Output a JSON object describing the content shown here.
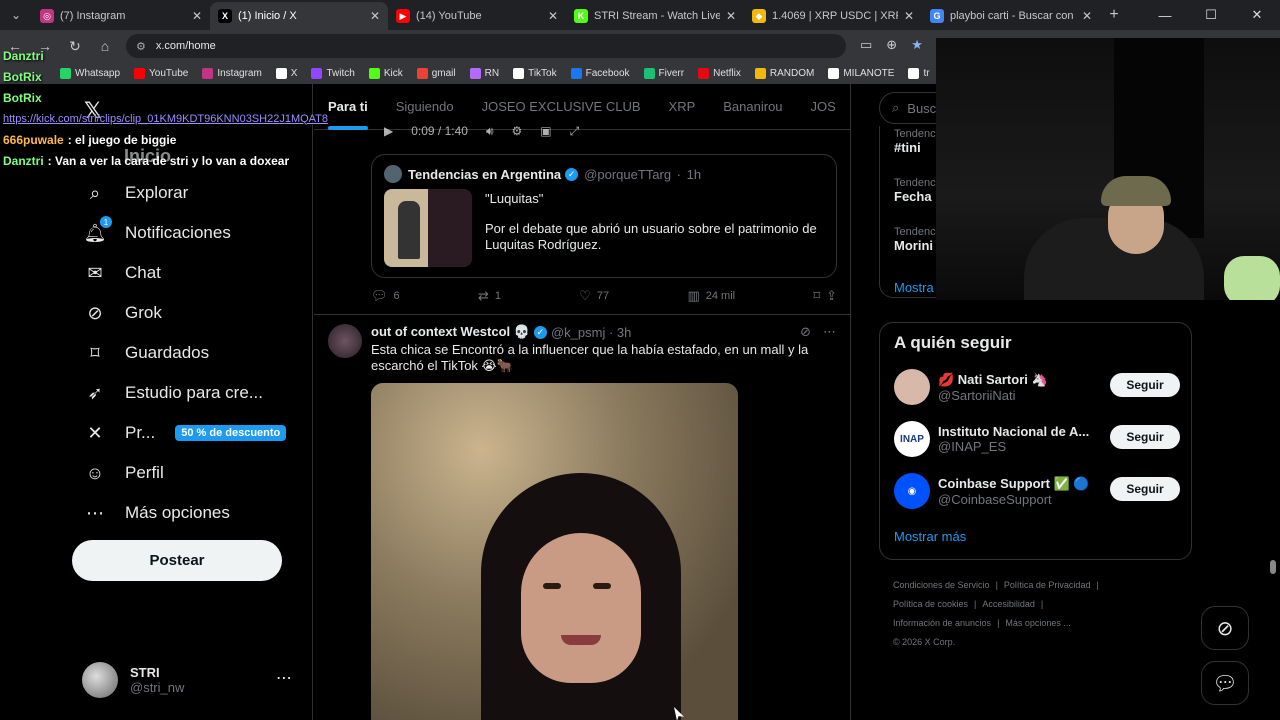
{
  "browser": {
    "tabs": [
      {
        "title": "(7) Instagram",
        "icon": "instagram-icon",
        "color": "#c13584",
        "glyph": "◎",
        "active": false
      },
      {
        "title": "(1) Inicio / X",
        "icon": "x-icon",
        "color": "#000000",
        "glyph": "X",
        "active": true
      },
      {
        "title": "(14) YouTube",
        "icon": "youtube-icon",
        "color": "#ff0000",
        "glyph": "▶",
        "active": false
      },
      {
        "title": "STRI Stream - Watch Live on",
        "icon": "kick-icon",
        "color": "#53fc18",
        "glyph": "K",
        "active": false
      },
      {
        "title": "1.4069 | XRP USDC | XRP to",
        "icon": "binance-icon",
        "color": "#f0b90b",
        "glyph": "◆",
        "active": false
      },
      {
        "title": "playboi carti - Buscar con Go",
        "icon": "google-icon",
        "color": "#4285f4",
        "glyph": "G",
        "active": false
      }
    ],
    "url": "x.com/home",
    "bookmarks": [
      {
        "label": "Whatsapp",
        "color": "#25d366"
      },
      {
        "label": "YouTube",
        "color": "#ff0000"
      },
      {
        "label": "Instagram",
        "color": "#c13584"
      },
      {
        "label": "X",
        "color": "#ffffff"
      },
      {
        "label": "Twitch",
        "color": "#9146ff"
      },
      {
        "label": "Kick",
        "color": "#53fc18"
      },
      {
        "label": "gmail",
        "color": "#ea4335"
      },
      {
        "label": "RN",
        "color": "#b36bff"
      },
      {
        "label": "TikTok",
        "color": "#ffffff"
      },
      {
        "label": "Facebook",
        "color": "#1877f2"
      },
      {
        "label": "Fiverr",
        "color": "#1dbf73"
      },
      {
        "label": "Netflix",
        "color": "#e50914"
      },
      {
        "label": "RANDOM",
        "color": "#f0b90b"
      },
      {
        "label": "MILANOTE",
        "color": "#ffffff"
      },
      {
        "label": "tr",
        "color": "#ffffff"
      }
    ]
  },
  "chat": [
    {
      "user": "Danztri",
      "user_color": "#7fff7f",
      "text": ""
    },
    {
      "user": "BotRix",
      "user_color": "#7fff7f",
      "text": ""
    },
    {
      "user": "BotRix",
      "user_color": "#7fff7f",
      "text": ""
    },
    {
      "user": "",
      "user_color": "#9b8cff",
      "link": "https://kick.com/stri/clips/clip_01KM9KDT96KNN03SH22J1MQAT8",
      "text": ""
    },
    {
      "user": "666puwale",
      "user_color": "#ffb84d",
      "text": ": el juego de biggie"
    },
    {
      "user": "Danztri",
      "user_color": "#7fff7f",
      "text": ": Van a ver la cara de stri y lo van a doxear"
    }
  ],
  "sidebar": {
    "home": "Inicio",
    "items": [
      {
        "label": "Explorar",
        "icon": "search-icon",
        "glyph": "⌕"
      },
      {
        "label": "Notificaciones",
        "icon": "bell-icon",
        "glyph": "🔔︎",
        "badge": "1"
      },
      {
        "label": "Chat",
        "icon": "mail-icon",
        "glyph": "✉"
      },
      {
        "label": "Grok",
        "icon": "grok-icon",
        "glyph": "⊘"
      },
      {
        "label": "Guardados",
        "icon": "bookmark-icon",
        "glyph": "⌑"
      },
      {
        "label": "Estudio para cre...",
        "icon": "rocket-icon",
        "glyph": "➶"
      },
      {
        "label": "Pr...",
        "icon": "x-premium-icon",
        "glyph": "✕",
        "tag": "50 % de descuento"
      },
      {
        "label": "Perfil",
        "icon": "person-icon",
        "glyph": "☺"
      },
      {
        "label": "Más opciones",
        "icon": "more-circle-icon",
        "glyph": "⋯"
      }
    ],
    "post_button": "Postear",
    "account": {
      "name": "STRI",
      "handle": "@stri_nw"
    }
  },
  "feed": {
    "tabs": [
      "Para ti",
      "Siguiendo",
      "JOSEO EXCLUSIVE CLUB",
      "XRP",
      "Bananirou",
      "JOS"
    ],
    "video_time": "0:09 / 1:40",
    "quote": {
      "author": "Tendencias en Argentina",
      "handle": "@porqueTTarg",
      "time": "1h",
      "title": "\"Luquitas\"",
      "text": "Por el debate que abrió un usuario sobre el patrimonio de Luquitas Rodríguez."
    },
    "actions": {
      "replies": "6",
      "reposts": "1",
      "likes": "77",
      "views": "24 mil"
    },
    "tweet": {
      "author": "out of context Westcol 💀",
      "handle": "@k_psmj",
      "time": "3h",
      "text": "Esta chica se Encontró a la influencer que la había estafado, en un mall y la escarchó el TikTok 😭🐂"
    }
  },
  "right": {
    "search_placeholder": "Busc",
    "trends": [
      {
        "category": "Tendenc",
        "name": "#tini"
      },
      {
        "category": "Tendenc",
        "name": "Fecha"
      },
      {
        "category": "Tendenc",
        "name": "Morini"
      }
    ],
    "trends_more": "Mostra",
    "follow_title": "A quién seguir",
    "follow": [
      {
        "name": "💋 Nati Sartori 🦄",
        "handle": "@SartoriiNati",
        "button": "Seguir",
        "avatar_color": "#d8b8a8",
        "avatar_text": ""
      },
      {
        "name": "Instituto Nacional de A...",
        "handle": "@INAP_ES",
        "button": "Seguir",
        "avatar_color": "#ffffff",
        "avatar_text": "INAP"
      },
      {
        "name": "Coinbase Support ✅ 🔵",
        "handle": "@CoinbaseSupport",
        "button": "Seguir",
        "avatar_color": "#0052ff",
        "avatar_text": "◉"
      }
    ],
    "follow_more": "Mostrar más",
    "footer": [
      "Condiciones de Servicio",
      "|",
      "Política de Privacidad",
      "|",
      "Política de cookies",
      "|",
      "Accesibilidad",
      "|",
      "Información de anuncios",
      "|",
      "Más opciones ...",
      "© 2026 X Corp."
    ]
  }
}
